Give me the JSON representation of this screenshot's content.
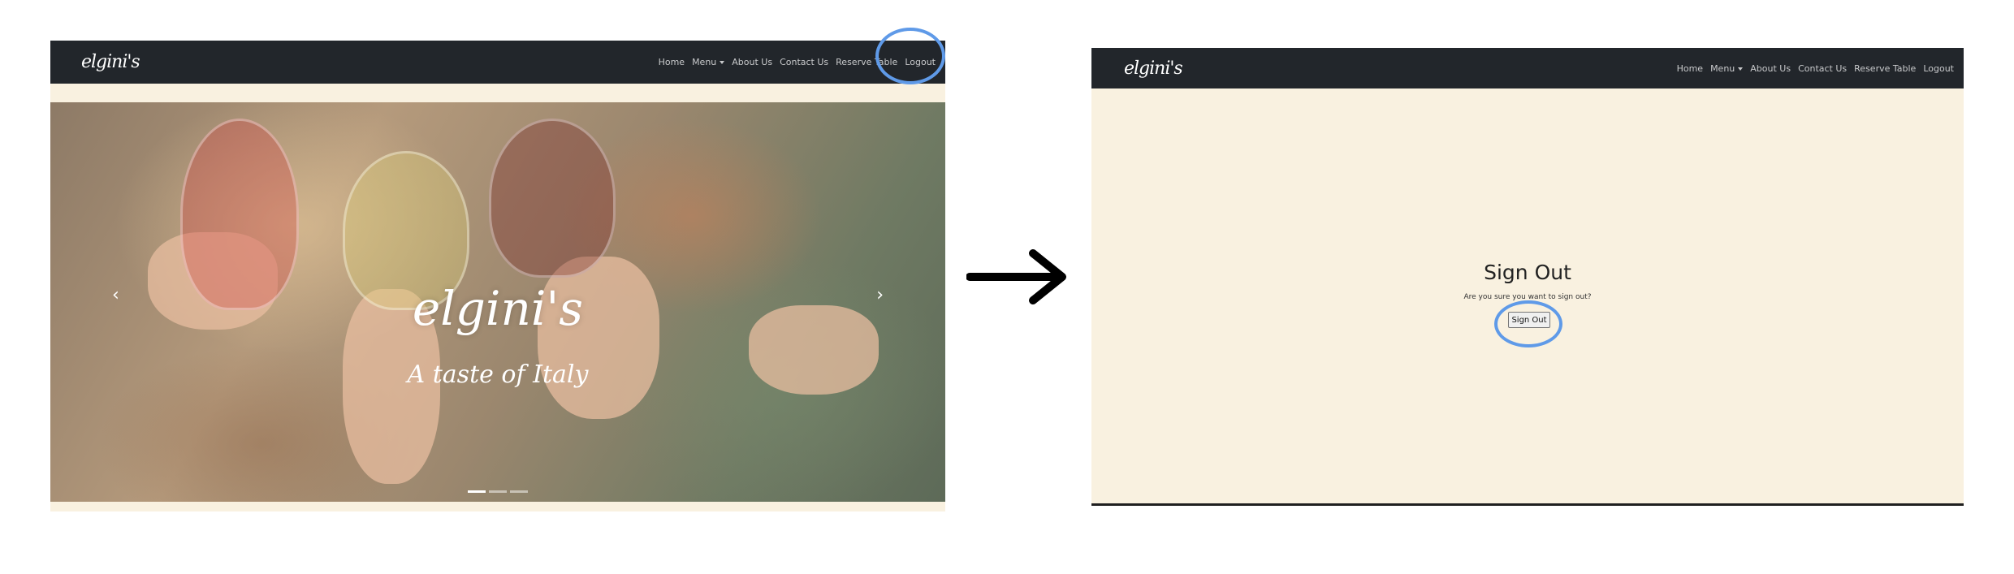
{
  "left": {
    "brand": "elgini's",
    "nav": [
      "Home",
      "Menu",
      "About Us",
      "Contact Us",
      "Reserve Table",
      "Logout"
    ],
    "hero": {
      "title": "elgini's",
      "subtitle": "A taste of Italy",
      "prev": "‹",
      "next": "›"
    }
  },
  "right": {
    "brand": "elgini's",
    "nav": [
      "Home",
      "Menu",
      "About Us",
      "Contact Us",
      "Reserve Table",
      "Logout"
    ],
    "page_title": "Sign Out",
    "prompt": "Are you sure you want to sign out?",
    "button": "Sign Out"
  },
  "colors": {
    "navbar": "#22262b",
    "page_background": "#f9f1e0",
    "highlight": "#5f9ae8"
  }
}
